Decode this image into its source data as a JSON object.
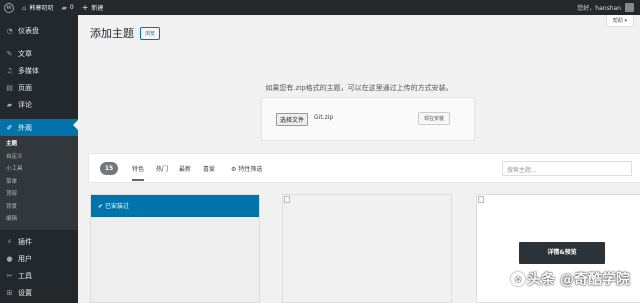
{
  "adminbar": {
    "site_name": "韩寒叨叨",
    "comments_count": "0",
    "new_label": "新建",
    "greeting": "您好，",
    "username": "hanshan"
  },
  "sidebar": {
    "items_top": [
      {
        "label": "仪表盘",
        "icon": "dashboard-icon"
      },
      {
        "label": "文章",
        "icon": "pin-icon"
      },
      {
        "label": "多媒体",
        "icon": "media-icon"
      },
      {
        "label": "页面",
        "icon": "page-icon"
      },
      {
        "label": "评论",
        "icon": "comment-icon"
      }
    ],
    "active_item": {
      "label": "外观",
      "icon": "brush-icon"
    },
    "submenu": [
      "主题",
      "自定义",
      "小工具",
      "菜单",
      "顶部",
      "背景",
      "编辑"
    ],
    "items_bottom": [
      {
        "label": "插件",
        "icon": "plugin-icon"
      },
      {
        "label": "用户",
        "icon": "user-icon"
      },
      {
        "label": "工具",
        "icon": "wrench-icon"
      },
      {
        "label": "设置",
        "icon": "settings-icon"
      }
    ]
  },
  "main": {
    "help_label": "帮助",
    "page_title": "添加主题",
    "browse_label": "浏览",
    "upload_help": "如果您有.zip格式的主题，可以在这里通过上传的方式安装。",
    "choose_file_label": "选择文件",
    "file_name": "Git.zip",
    "install_label": "现在安装"
  },
  "filter": {
    "count": "15",
    "tabs": [
      "特色",
      "热门",
      "最新",
      "喜爱"
    ],
    "feature_filter_label": "特性筛选",
    "search_placeholder": "搜索主题..."
  },
  "themes": {
    "installed_label": "已安装过",
    "details_label": "详情&预览"
  },
  "watermark": {
    "text": "头条 @奇酷学院"
  }
}
